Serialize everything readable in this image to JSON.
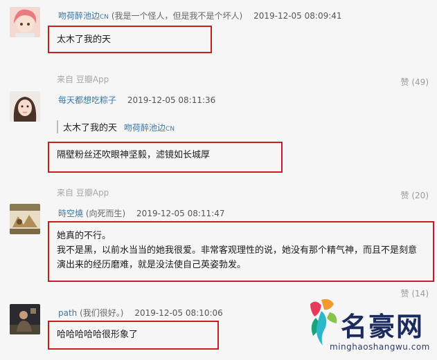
{
  "comments": [
    {
      "username": "吻荷醉池边",
      "user_tag": "CN",
      "signature": "(我是一个怪人，但是我不是个坏人)",
      "time": "2019-12-05 08:09:41",
      "lines": [
        "太木了我的天"
      ],
      "source": "",
      "likes": "赞 (49)"
    },
    {
      "username": "每天都想吃粽子",
      "user_tag": "",
      "signature": "",
      "time": "2019-12-05 08:11:36",
      "quote_text": "太木了我的天",
      "quote_user": "吻荷醉池边",
      "quote_user_tag": "CN",
      "lines": [
        "隔壁粉丝还吹眼神坚毅，滤镜如长城厚"
      ],
      "source": "来自 豆瓣App",
      "likes": "赞 (20)"
    },
    {
      "username": "時空燒",
      "user_tag": "",
      "signature": "(向死而生)",
      "time": "2019-12-05 08:11:47",
      "lines": [
        "她真的不行。",
        "我不是黑，以前水当当的她我很爱。非常客观理性的说，她没有那个精气神，而且不是刻意",
        "演出来的经历磨难，就是没法使自己英姿勃发。"
      ],
      "source": "来自 豆瓣App",
      "likes": "赞 (14)"
    },
    {
      "username": "path",
      "user_tag": "",
      "signature": "(我们很好。)",
      "time": "2019-12-05 08:10:06",
      "lines": [
        "哈哈哈哈哈很形象了"
      ],
      "source": "",
      "likes": ""
    }
  ],
  "first_source": "来自 豆瓣App",
  "watermark": {
    "text": "名豪网",
    "url": "minghaoshangwu.com"
  },
  "colors": {
    "username": "#3a77a8",
    "highlight_box": "#c81c24",
    "background": "#f6f6f6"
  }
}
